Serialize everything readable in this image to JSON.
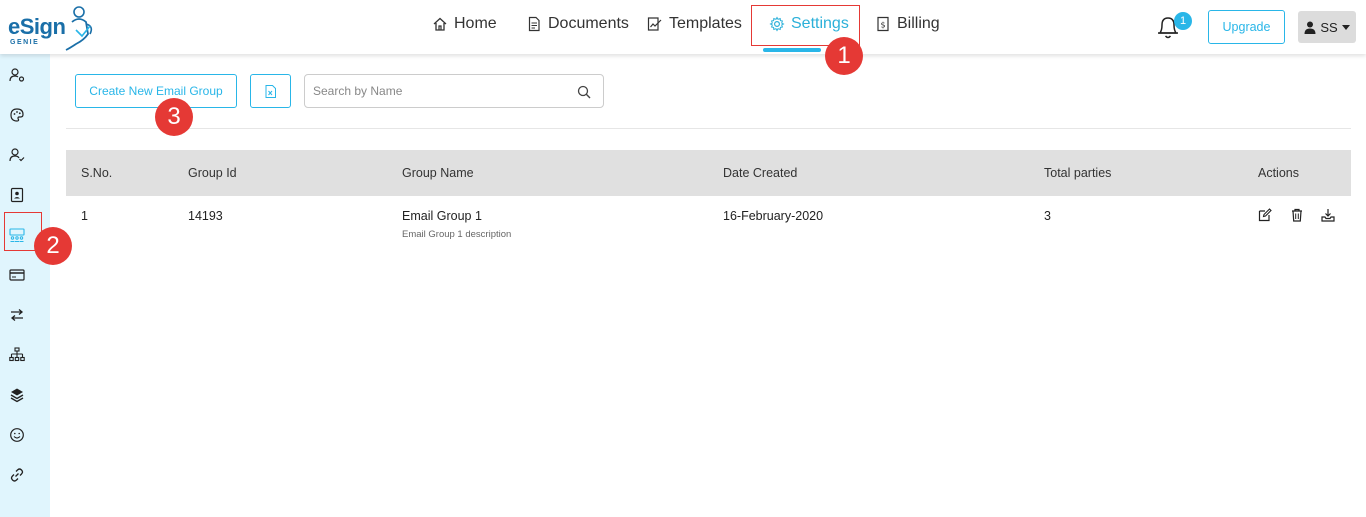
{
  "header": {
    "logo_text": "eSign",
    "logo_sub": "GENIE",
    "nav": [
      {
        "label": "Home",
        "icon": "home-icon"
      },
      {
        "label": "Documents",
        "icon": "document-icon"
      },
      {
        "label": "Templates",
        "icon": "template-icon"
      },
      {
        "label": "Settings",
        "icon": "gear-icon",
        "active": true
      },
      {
        "label": "Billing",
        "icon": "billing-icon"
      }
    ],
    "notification_count": "1",
    "upgrade_label": "Upgrade",
    "user_initials": "SS"
  },
  "annotations": {
    "marker_1": "1",
    "marker_2": "2",
    "marker_3": "3"
  },
  "sidebar": {
    "items": [
      {
        "icon": "user-settings-icon"
      },
      {
        "icon": "palette-icon"
      },
      {
        "icon": "user-check-icon"
      },
      {
        "icon": "contact-card-icon"
      },
      {
        "icon": "email-group-icon",
        "highlighted": true
      },
      {
        "icon": "credit-card-icon"
      },
      {
        "icon": "transfer-icon"
      },
      {
        "icon": "hierarchy-icon"
      },
      {
        "icon": "layers-icon"
      },
      {
        "icon": "smiley-icon"
      },
      {
        "icon": "link-icon"
      }
    ]
  },
  "toolbar": {
    "create_label": "Create New Email Group",
    "excel_icon": "excel-icon",
    "search_placeholder": "Search by Name"
  },
  "table": {
    "columns": [
      "S.No.",
      "Group Id",
      "Group Name",
      "Date Created",
      "Total parties",
      "Actions"
    ],
    "rows": [
      {
        "sno": "1",
        "group_id": "14193",
        "group_name": "Email Group 1",
        "group_desc": "Email Group 1 description",
        "date_created": "16-February-2020",
        "total_parties": "3"
      }
    ]
  },
  "colors": {
    "accent": "#29b6e8",
    "annotation": "#e53935",
    "sidebar_bg": "#e0f5fd",
    "table_header_bg": "#e0e0e0"
  }
}
